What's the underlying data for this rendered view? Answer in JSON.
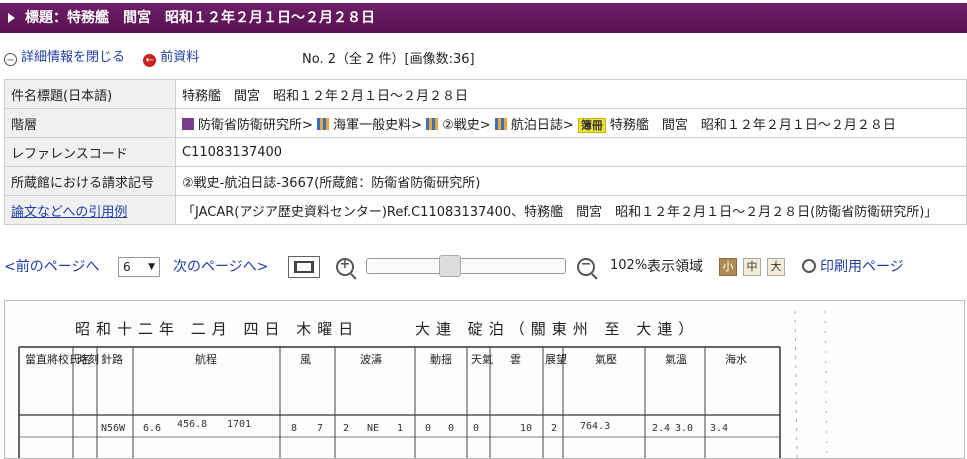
{
  "header": {
    "title": "標題：特務艦　間宮　昭和１２年２月１日～２月２８日"
  },
  "actions": {
    "close_details": "詳細情報を閉じる",
    "prev_item": "前資料",
    "count": "No. 2（全 2 件）[画像数:36]"
  },
  "info": {
    "rows": [
      {
        "label": "件名標題(日本語)",
        "value": "特務艦　間宮　昭和１２年２月１日～２月２８日"
      },
      {
        "label": "階層"
      },
      {
        "label": "レファレンスコード",
        "value": "C11083137400"
      },
      {
        "label": "所蔵館における請求記号",
        "value": "②戦史-航泊日誌-3667(所蔵館：防衛省防衛研究所)"
      },
      {
        "label": "論文などへの引用例",
        "value": "「JACAR(アジア歴史資料センター)Ref.C11083137400、特務艦　間宮　昭和１２年２月１日～２月２８日(防衛省防衛研究所)」"
      }
    ],
    "hierarchy": {
      "items": [
        "防衛省防衛研究所",
        "海軍一般史料",
        "②戦史",
        "航泊日誌"
      ],
      "separator": ">",
      "book_tag": "簿冊",
      "current": "特務艦　間宮　昭和１２年２月１日～２月２８日"
    }
  },
  "viewer": {
    "prev_page": "<前のページへ",
    "page_selected": "6",
    "next_page": "次のページへ>",
    "zoom": "102%",
    "zoom_level_fraction": 0.41,
    "display_area_label": "表示領域",
    "sizes": [
      "小",
      "中",
      "大"
    ],
    "print_page": "印刷用ページ"
  },
  "document": {
    "heading": "昭和十二年 二月 四日 木曜日",
    "location": "大連 碇泊（關東州 至 大連）",
    "columns": [
      "當直將校氏名",
      "時刻",
      "針路",
      "航程",
      "風",
      "波濤",
      "動揺",
      "天氣",
      "雲",
      "展望",
      "氣壓",
      "氣溫",
      "海水"
    ],
    "row_values": [
      "N56W",
      "6.6",
      "456.8",
      "1701",
      "8",
      "7",
      "2",
      "NE",
      "1",
      "0",
      "0",
      "0",
      "10",
      "2",
      "764.3",
      "2.4",
      "3.0",
      "3.4"
    ]
  },
  "colors": {
    "title_bar": "#5e1557",
    "link": "#1f3ea8",
    "label_bg": "#f0f0f0"
  }
}
